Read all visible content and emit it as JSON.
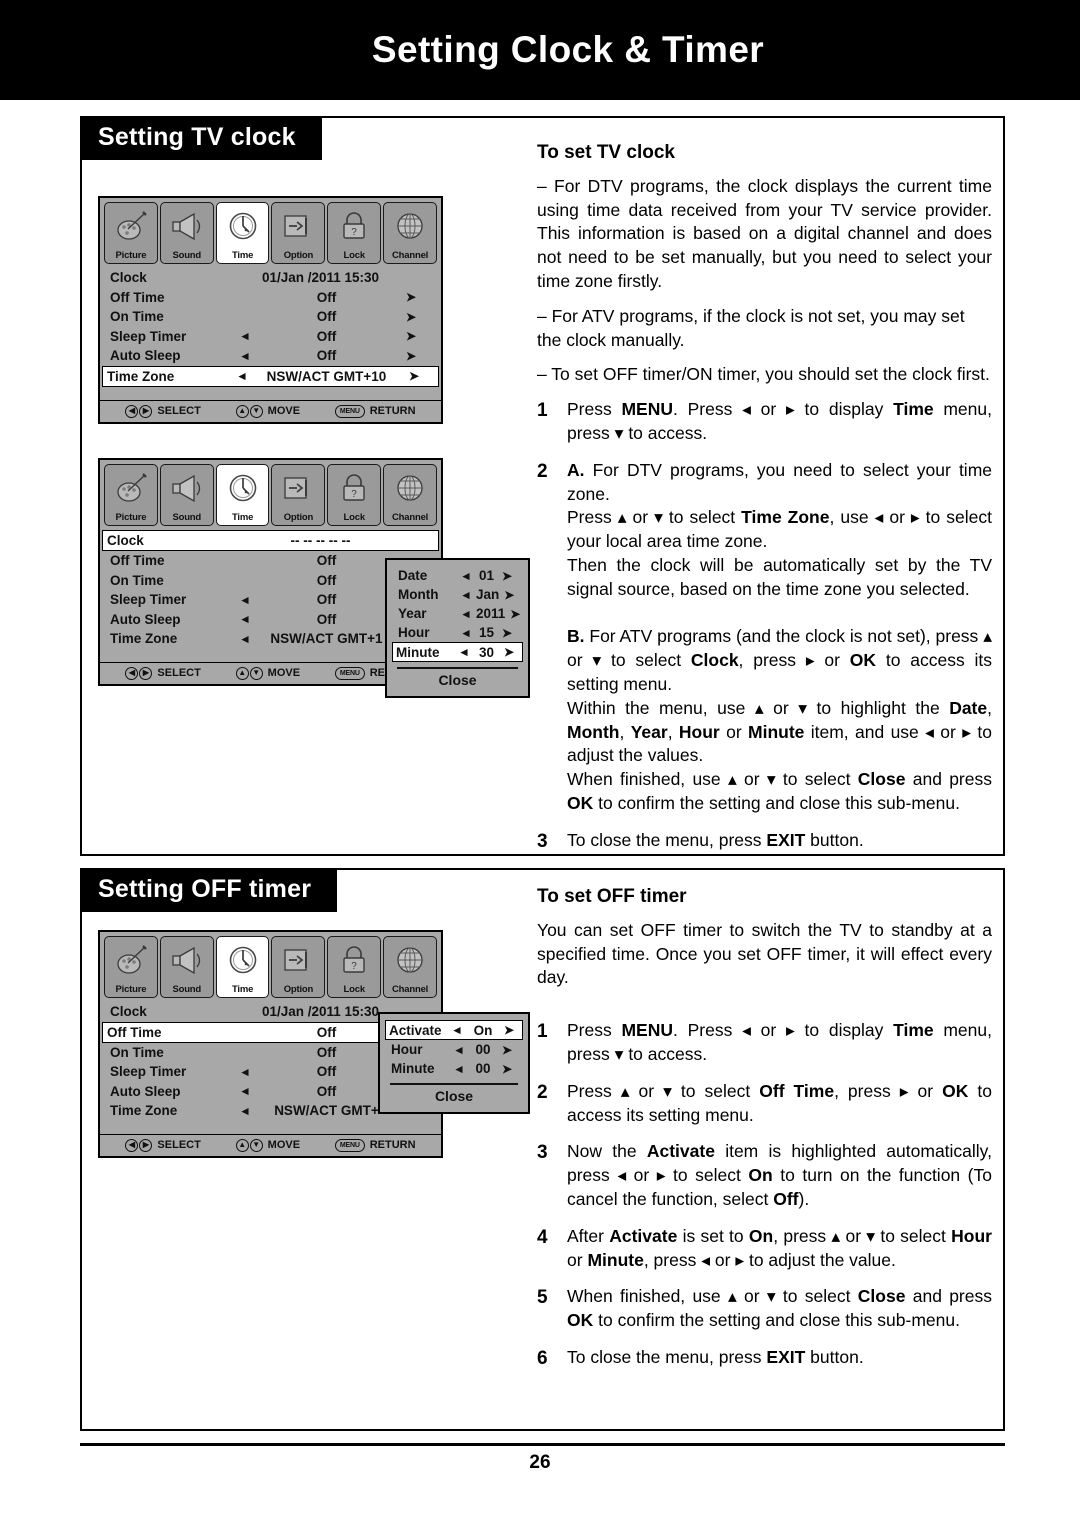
{
  "header": {
    "title": "Setting Clock & Timer"
  },
  "page": {
    "number": "26"
  },
  "sections": {
    "clock": {
      "tag": "Setting TV clock"
    },
    "offtimer": {
      "tag": "Setting OFF timer"
    }
  },
  "osd": {
    "tabs": [
      {
        "label": "Picture",
        "icon": "picture-icon"
      },
      {
        "label": "Sound",
        "icon": "sound-icon"
      },
      {
        "label": "Time",
        "icon": "clock-icon"
      },
      {
        "label": "Option",
        "icon": "option-icon"
      },
      {
        "label": "Lock",
        "icon": "lock-icon"
      },
      {
        "label": "Channel",
        "icon": "globe-icon"
      }
    ],
    "footer": {
      "select": "SELECT",
      "move": "MOVE",
      "return": "RETURN",
      "menu_key": "MENU"
    },
    "arrows": {
      "left": "◄",
      "right": "➤",
      "up": "Ⓐ",
      "down": "Ⓥ"
    },
    "menu1": {
      "rows": [
        {
          "label": "Clock",
          "left": "",
          "value": "01/Jan /2011 15:30",
          "right": "",
          "highlight": false
        },
        {
          "label": "Off Time",
          "left": "",
          "value": "Off",
          "right": "➤",
          "highlight": false
        },
        {
          "label": "On Time",
          "left": "",
          "value": "Off",
          "right": "➤",
          "highlight": false
        },
        {
          "label": "Sleep Timer",
          "left": "◄",
          "value": "Off",
          "right": "➤",
          "highlight": false
        },
        {
          "label": "Auto Sleep",
          "left": "◄",
          "value": "Off",
          "right": "➤",
          "highlight": false
        },
        {
          "label": "Time Zone",
          "left": "◄",
          "value": "NSW/ACT GMT+10",
          "right": "➤",
          "highlight": true
        }
      ]
    },
    "menu2": {
      "rows": [
        {
          "label": "Clock",
          "left": "",
          "value": "--  --  --   --  --",
          "right": "",
          "highlight": true
        },
        {
          "label": "Off Time",
          "left": "",
          "value": "Off",
          "right": "",
          "highlight": false
        },
        {
          "label": "On Time",
          "left": "",
          "value": "Off",
          "right": "",
          "highlight": false
        },
        {
          "label": "Sleep Timer",
          "left": "◄",
          "value": "Off",
          "right": "",
          "highlight": false
        },
        {
          "label": "Auto Sleep",
          "left": "◄",
          "value": "Off",
          "right": "",
          "highlight": false
        },
        {
          "label": "Time Zone",
          "left": "◄",
          "value": "NSW/ACT GMT+1",
          "right": "",
          "highlight": false
        }
      ],
      "popup": {
        "rows": [
          {
            "label": "Date",
            "left": "◄",
            "value": "01",
            "right": "➤",
            "highlight": false
          },
          {
            "label": "Month",
            "left": "◄",
            "value": "Jan",
            "right": "➤",
            "highlight": false
          },
          {
            "label": "Year",
            "left": "◄",
            "value": "2011",
            "right": "➤",
            "highlight": false
          },
          {
            "label": "Hour",
            "left": "◄",
            "value": "15",
            "right": "➤",
            "highlight": false
          },
          {
            "label": "Minute",
            "left": "◄",
            "value": "30",
            "right": "➤",
            "highlight": true
          }
        ],
        "close": "Close"
      }
    },
    "menu3": {
      "rows": [
        {
          "label": "Clock",
          "left": "",
          "value": "01/Jan /2011 15:30",
          "right": "",
          "highlight": false
        },
        {
          "label": "Off Time",
          "left": "",
          "value": "Off",
          "right": "",
          "highlight": true
        },
        {
          "label": "On Time",
          "left": "",
          "value": "Off",
          "right": "",
          "highlight": false
        },
        {
          "label": "Sleep Timer",
          "left": "◄",
          "value": "Off",
          "right": "",
          "highlight": false
        },
        {
          "label": "Auto Sleep",
          "left": "◄",
          "value": "Off",
          "right": "",
          "highlight": false
        },
        {
          "label": "Time Zone",
          "left": "◄",
          "value": "NSW/ACT GMT+",
          "right": "",
          "highlight": false
        }
      ],
      "popup": {
        "rows": [
          {
            "label": "Activate",
            "left": "◄",
            "value": "On",
            "right": "➤",
            "highlight": true
          },
          {
            "label": "Hour",
            "left": "◄",
            "value": "00",
            "right": "➤",
            "highlight": false
          },
          {
            "label": "Minute",
            "left": "◄",
            "value": "00",
            "right": "➤",
            "highlight": false
          }
        ],
        "close": "Close"
      }
    }
  },
  "clock_text": {
    "heading": "To set TV clock",
    "bullets": [
      "– For DTV programs, the clock displays the current time using time data received from your TV service provider. This information is based on a digital channel and does not need to be set manually, but you need to select your time zone firstly.",
      "– For ATV programs, if the clock is not set, you may set the clock manually.",
      "– To set OFF timer/ON timer, you should set the clock first."
    ],
    "steps": [
      {
        "num": "1"
      },
      {
        "num": "2"
      },
      {
        "num": "3"
      }
    ],
    "step1_a": "Press ",
    "step1_menu": "MENU",
    "step1_b": ". Press ",
    "step1_c": " or ",
    "step1_d": " to display ",
    "step1_time": "Time",
    "step1_e": " menu, press ",
    "step1_f": " to access.",
    "step2_A": "A.",
    "step2_a": " For DTV programs, you need to select your time zone.",
    "step2_b": "Press ",
    "step2_c": " or ",
    "step2_d": " to select ",
    "step2_tz": "Time Zone",
    "step2_e": ", use ",
    "step2_f": " or ",
    "step2_g": " to select your local area time zone.",
    "step2_h": "Then the clock will be automatically set by the TV signal source, based on the time zone you selected.",
    "step2_B": "B.",
    "step2_i": " For ATV programs (and the clock is not set), press ",
    "step2_j": " or ",
    "step2_k": " to select ",
    "step2_clock": "Clock",
    "step2_l": ", press ",
    "step2_m": " or ",
    "step2_ok": "OK",
    "step2_n": " to access its setting menu.",
    "step2_o": "Within the menu, use ",
    "step2_p": " or ",
    "step2_q": " to highlight the ",
    "step2_date": "Date",
    "step2_month": "Month",
    "step2_year": "Year",
    "step2_hour": "Hour",
    "step2_minute": "Minute",
    "step2_r": " item, and use ",
    "step2_s": " or ",
    "step2_t": " to adjust the values.",
    "step2_u": "When finished, use ",
    "step2_v": " or ",
    "step2_w": " to select ",
    "step2_close": "Close",
    "step2_x": " and press ",
    "step2_ok2": "OK",
    "step2_y": " to confirm the setting and close this sub-menu.",
    "step3_a": "To close the menu, press ",
    "step3_exit": "EXIT",
    "step3_b": " button."
  },
  "offtimer_text": {
    "heading": "To set OFF timer",
    "intro": "You can set OFF timer to switch the TV to standby at a specified time.  Once you set OFF timer, it will effect every day.",
    "s1_a": "Press ",
    "s1_menu": "MENU",
    "s1_b": ". Press ",
    "s1_c": " or ",
    "s1_d": " to display ",
    "s1_time": "Time",
    "s1_e": " menu, press ",
    "s1_f": " to access.",
    "s2_a": "Press ",
    "s2_b": " or ",
    "s2_c": " to select ",
    "s2_offtime": "Off Time",
    "s2_d": ", press ",
    "s2_e": " or ",
    "s2_ok": "OK",
    "s2_f": " to access its setting menu.",
    "s3_a": "Now the ",
    "s3_activate": "Activate",
    "s3_b": " item is highlighted automatically, press ",
    "s3_c": " or ",
    "s3_d": " to select ",
    "s3_on": "On",
    "s3_e": " to turn on the function (To cancel the function, select ",
    "s3_off": "Off",
    "s3_f": ").",
    "s4_a": "After ",
    "s4_activate": "Activate",
    "s4_b": " is set to ",
    "s4_on": "On",
    "s4_c": ", press ",
    "s4_d": " or ",
    "s4_e": " to select ",
    "s4_hour": "Hour",
    "s4_f": " or ",
    "s4_minute": "Minute",
    "s4_g": ", press ",
    "s4_h": " or ",
    "s4_i": " to adjust the value.",
    "s5_a": "When finished, use ",
    "s5_b": " or ",
    "s5_c": " to select ",
    "s5_close": "Close",
    "s5_d": " and press ",
    "s5_ok": "OK",
    "s5_e": " to confirm the setting and close this sub-menu.",
    "s6_a": "To close the menu, press ",
    "s6_exit": "EXIT",
    "s6_b": " button.",
    "nums": [
      "1",
      "2",
      "3",
      "4",
      "5",
      "6"
    ]
  },
  "glyphs": {
    "left_tri": "◂",
    "right_tri": "▸",
    "up_tri": "▴",
    "down_tri": "▾"
  }
}
